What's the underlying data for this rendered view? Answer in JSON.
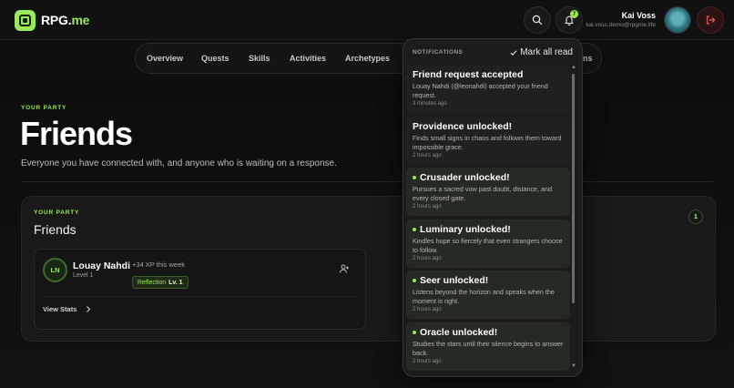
{
  "app": {
    "brand": "RPG.",
    "brand_suffix": "me"
  },
  "header": {
    "user_name": "Kai Voss",
    "user_email": "kai.voss.demo@rpgme.life",
    "notification_count": "7"
  },
  "nav": {
    "items": [
      "Overview",
      "Quests",
      "Skills",
      "Activities",
      "Archetypes"
    ],
    "hidden_tail": "ns"
  },
  "hero": {
    "eyebrow": "YOUR PARTY",
    "title": "Friends",
    "subtitle": "Everyone you have connected with, and anyone who is waiting on a response."
  },
  "card": {
    "eyebrow": "YOUR PARTY",
    "title": "Friends",
    "count": "1",
    "friend": {
      "initials": "LN",
      "name": "Louay Nahdi",
      "level": "Level 1",
      "xp": "+34 XP this week",
      "tag_label": "Reflection",
      "tag_level": "Lv. 1",
      "view_stats": "View Stats"
    }
  },
  "notifications": {
    "header": "NOTIFICATIONS",
    "mark_all": "Mark all read",
    "items": [
      {
        "title": "Friend request accepted",
        "body": "Louay Nahdi (@leonahdi) accepted your friend request.",
        "time": "3 minutes ago",
        "unread": false
      },
      {
        "title": "Providence unlocked!",
        "body": "Finds small signs in chaos and follows them toward impossible grace.",
        "time": "2 hours ago",
        "unread": false
      },
      {
        "title": "Crusader unlocked!",
        "body": "Pursues a sacred vow past doubt, distance, and every closed gate.",
        "time": "2 hours ago",
        "unread": true
      },
      {
        "title": "Luminary unlocked!",
        "body": "Kindles hope so fiercely that even strangers choose to follow.",
        "time": "2 hours ago",
        "unread": true
      },
      {
        "title": "Seer unlocked!",
        "body": "Listens beyond the horizon and speaks when the moment is right.",
        "time": "2 hours ago",
        "unread": true
      },
      {
        "title": "Oracle unlocked!",
        "body": "Studies the stars until their silence begins to answer back.",
        "time": "2 hours ago",
        "unread": true
      }
    ]
  },
  "colors": {
    "accent": "#9be85a",
    "background": "#0f0f10",
    "danger": "#e05a5a"
  }
}
